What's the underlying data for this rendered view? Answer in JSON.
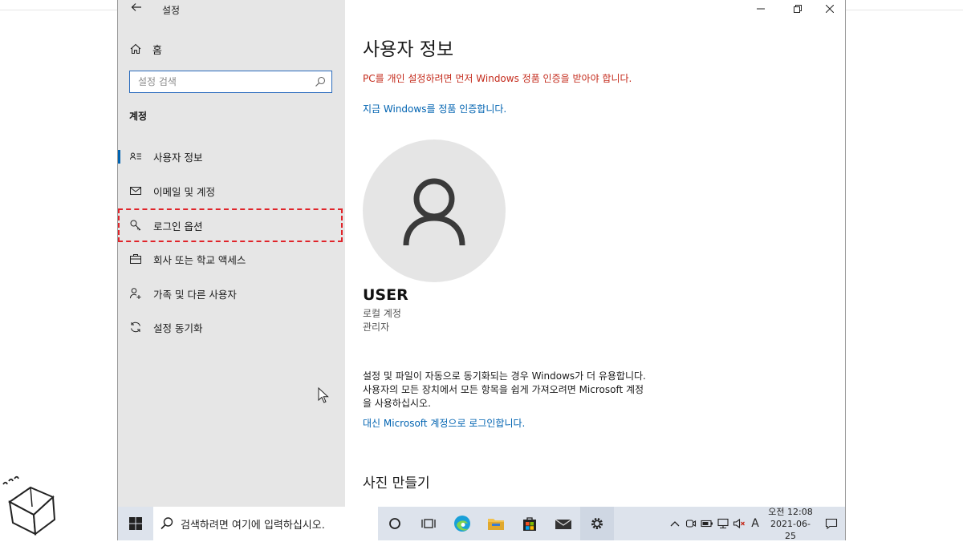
{
  "app": {
    "title": "설정"
  },
  "sidebar": {
    "home_label": "홈",
    "search_placeholder": "설정 검색",
    "section": "계정",
    "items": [
      {
        "label": "사용자 정보",
        "icon": "person-card-icon"
      },
      {
        "label": "이메일 및 계정",
        "icon": "mail-icon"
      },
      {
        "label": "로그인 옵션",
        "icon": "key-icon"
      },
      {
        "label": "회사 또는 학교 액세스",
        "icon": "briefcase-icon"
      },
      {
        "label": "가족 및 다른 사용자",
        "icon": "person-add-icon"
      },
      {
        "label": "설정 동기화",
        "icon": "sync-icon"
      }
    ]
  },
  "main": {
    "title": "사용자 정보",
    "warning": "PC를 개인 설정하려면 먼저 Windows 정품 인증을 받아야 합니다.",
    "activate_link": "지금 Windows를 정품 인증합니다.",
    "user_name": "USER",
    "account_type": "로컬 계정",
    "account_role": "관리자",
    "sync_desc_1": "설정 및 파일이 자동으로 동기화되는 경우 Windows가 더 유용합니다.",
    "sync_desc_2": "사용자의 모든 장치에서 모든 항목을 쉽게 가져오려면 Microsoft 계정",
    "sync_desc_3": "을 사용하십시오.",
    "ms_link": "대신 Microsoft 계정으로 로그인합니다.",
    "photo_heading": "사진 만들기"
  },
  "taskbar": {
    "search_placeholder": "검색하려면 여기에 입력하십시오.",
    "ime": "A",
    "clock_time": "오전 12:08",
    "clock_date": "2021-06-25"
  },
  "colors": {
    "accent": "#0063b1",
    "warning": "#c42b1c",
    "highlight": "#e0242a"
  }
}
